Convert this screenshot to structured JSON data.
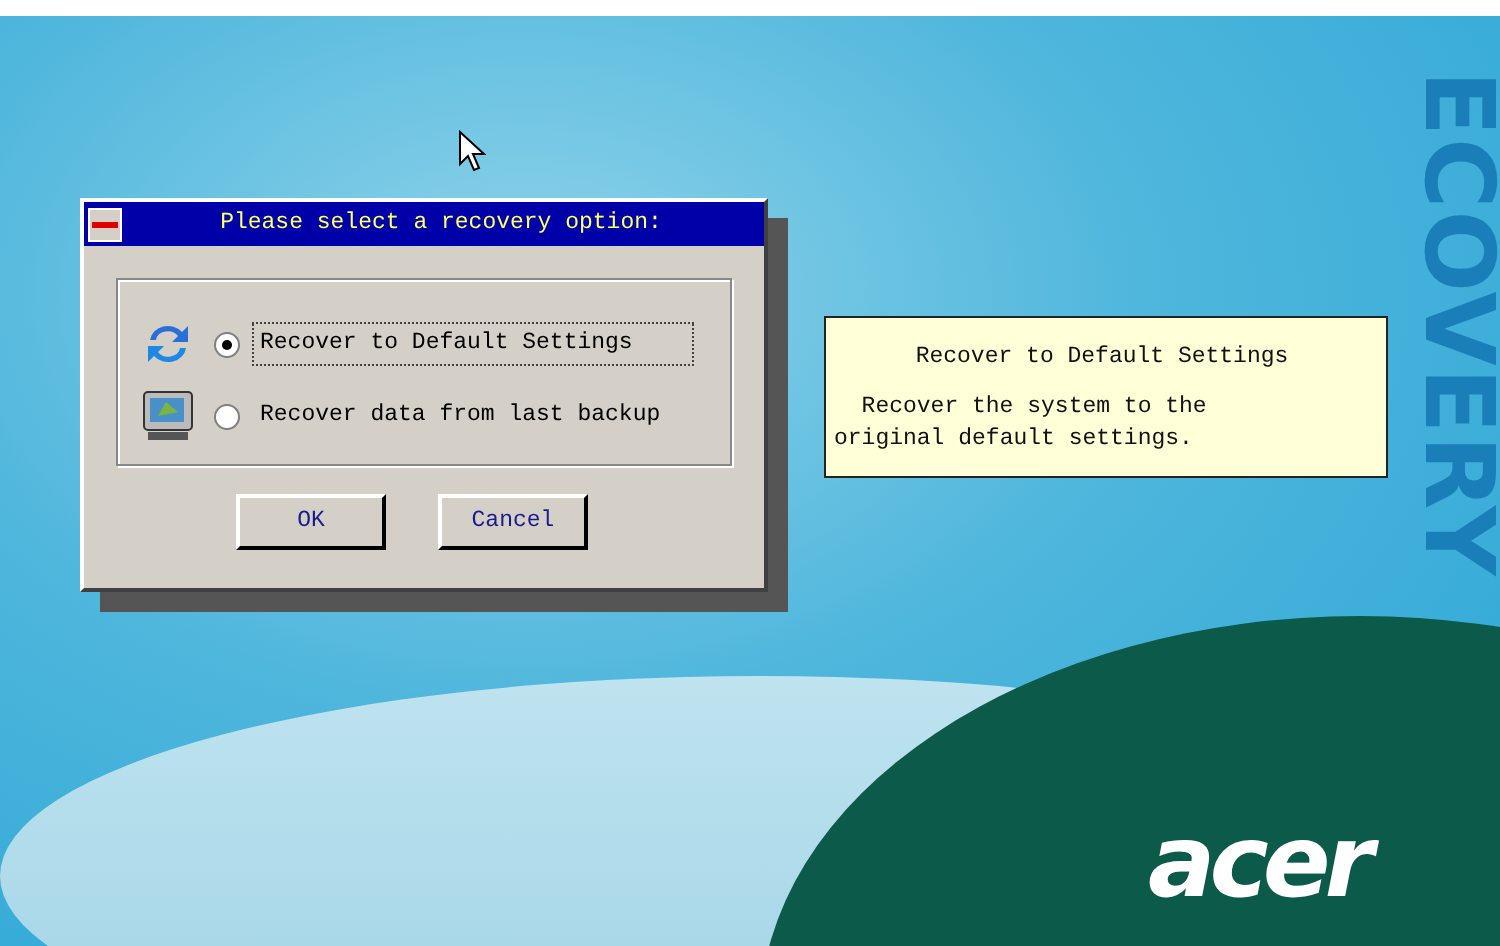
{
  "background": {
    "side_text": "ECOVERY",
    "logo": "acer"
  },
  "dialog": {
    "title": "Please select a recovery option:",
    "options": [
      {
        "kind": "refresh",
        "label": "Recover to Default Settings",
        "selected": true,
        "focused": true
      },
      {
        "kind": "monitor",
        "label": "Recover data from last backup",
        "selected": false,
        "focused": false
      }
    ],
    "buttons": [
      "OK",
      "Cancel"
    ]
  },
  "info_box": {
    "title": "Recover to Default Settings",
    "text": "Recover the system to the original default settings."
  }
}
